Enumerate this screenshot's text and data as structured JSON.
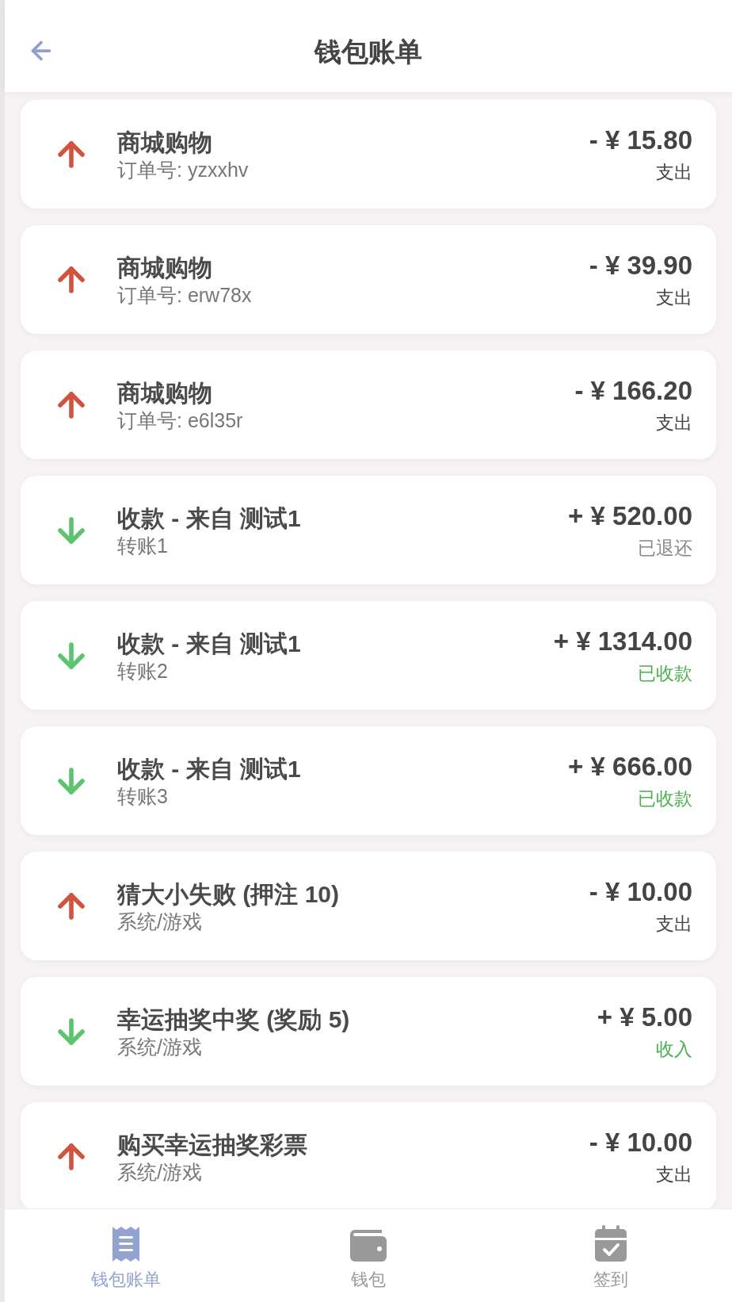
{
  "header": {
    "title": "钱包账单"
  },
  "transactions": [
    {
      "kind": "expense",
      "title": "商城购物",
      "subtitle": "订单号: yzxxhv",
      "amount": "- ¥ 15.80",
      "status": "支出"
    },
    {
      "kind": "expense",
      "title": "商城购物",
      "subtitle": "订单号: erw78x",
      "amount": "- ¥ 39.90",
      "status": "支出"
    },
    {
      "kind": "expense",
      "title": "商城购物",
      "subtitle": "订单号: e6l35r",
      "amount": "- ¥ 166.20",
      "status": "支出"
    },
    {
      "kind": "refunded",
      "title": "收款 - 来自 测试1",
      "subtitle": "转账1",
      "amount": "+ ¥ 520.00",
      "status": "已退还"
    },
    {
      "kind": "received",
      "title": "收款 - 来自 测试1",
      "subtitle": "转账2",
      "amount": "+ ¥ 1314.00",
      "status": "已收款"
    },
    {
      "kind": "received",
      "title": "收款 - 来自 测试1",
      "subtitle": "转账3",
      "amount": "+ ¥ 666.00",
      "status": "已收款"
    },
    {
      "kind": "expense",
      "title": "猜大小失败 (押注 10)",
      "subtitle": "系统/游戏",
      "amount": "- ¥ 10.00",
      "status": "支出"
    },
    {
      "kind": "received",
      "title": "幸运抽奖中奖 (奖励 5)",
      "subtitle": "系统/游戏",
      "amount": "+ ¥ 5.00",
      "status": "收入"
    },
    {
      "kind": "expense",
      "title": "购买幸运抽奖彩票",
      "subtitle": "系统/游戏",
      "amount": "- ¥ 10.00",
      "status": "支出"
    }
  ],
  "tab_bar": [
    {
      "kind": "bill",
      "label": "钱包账单",
      "selected": true
    },
    {
      "kind": "wallet",
      "label": "钱包",
      "selected": false
    },
    {
      "kind": "checkin",
      "label": "签到",
      "selected": false
    }
  ]
}
